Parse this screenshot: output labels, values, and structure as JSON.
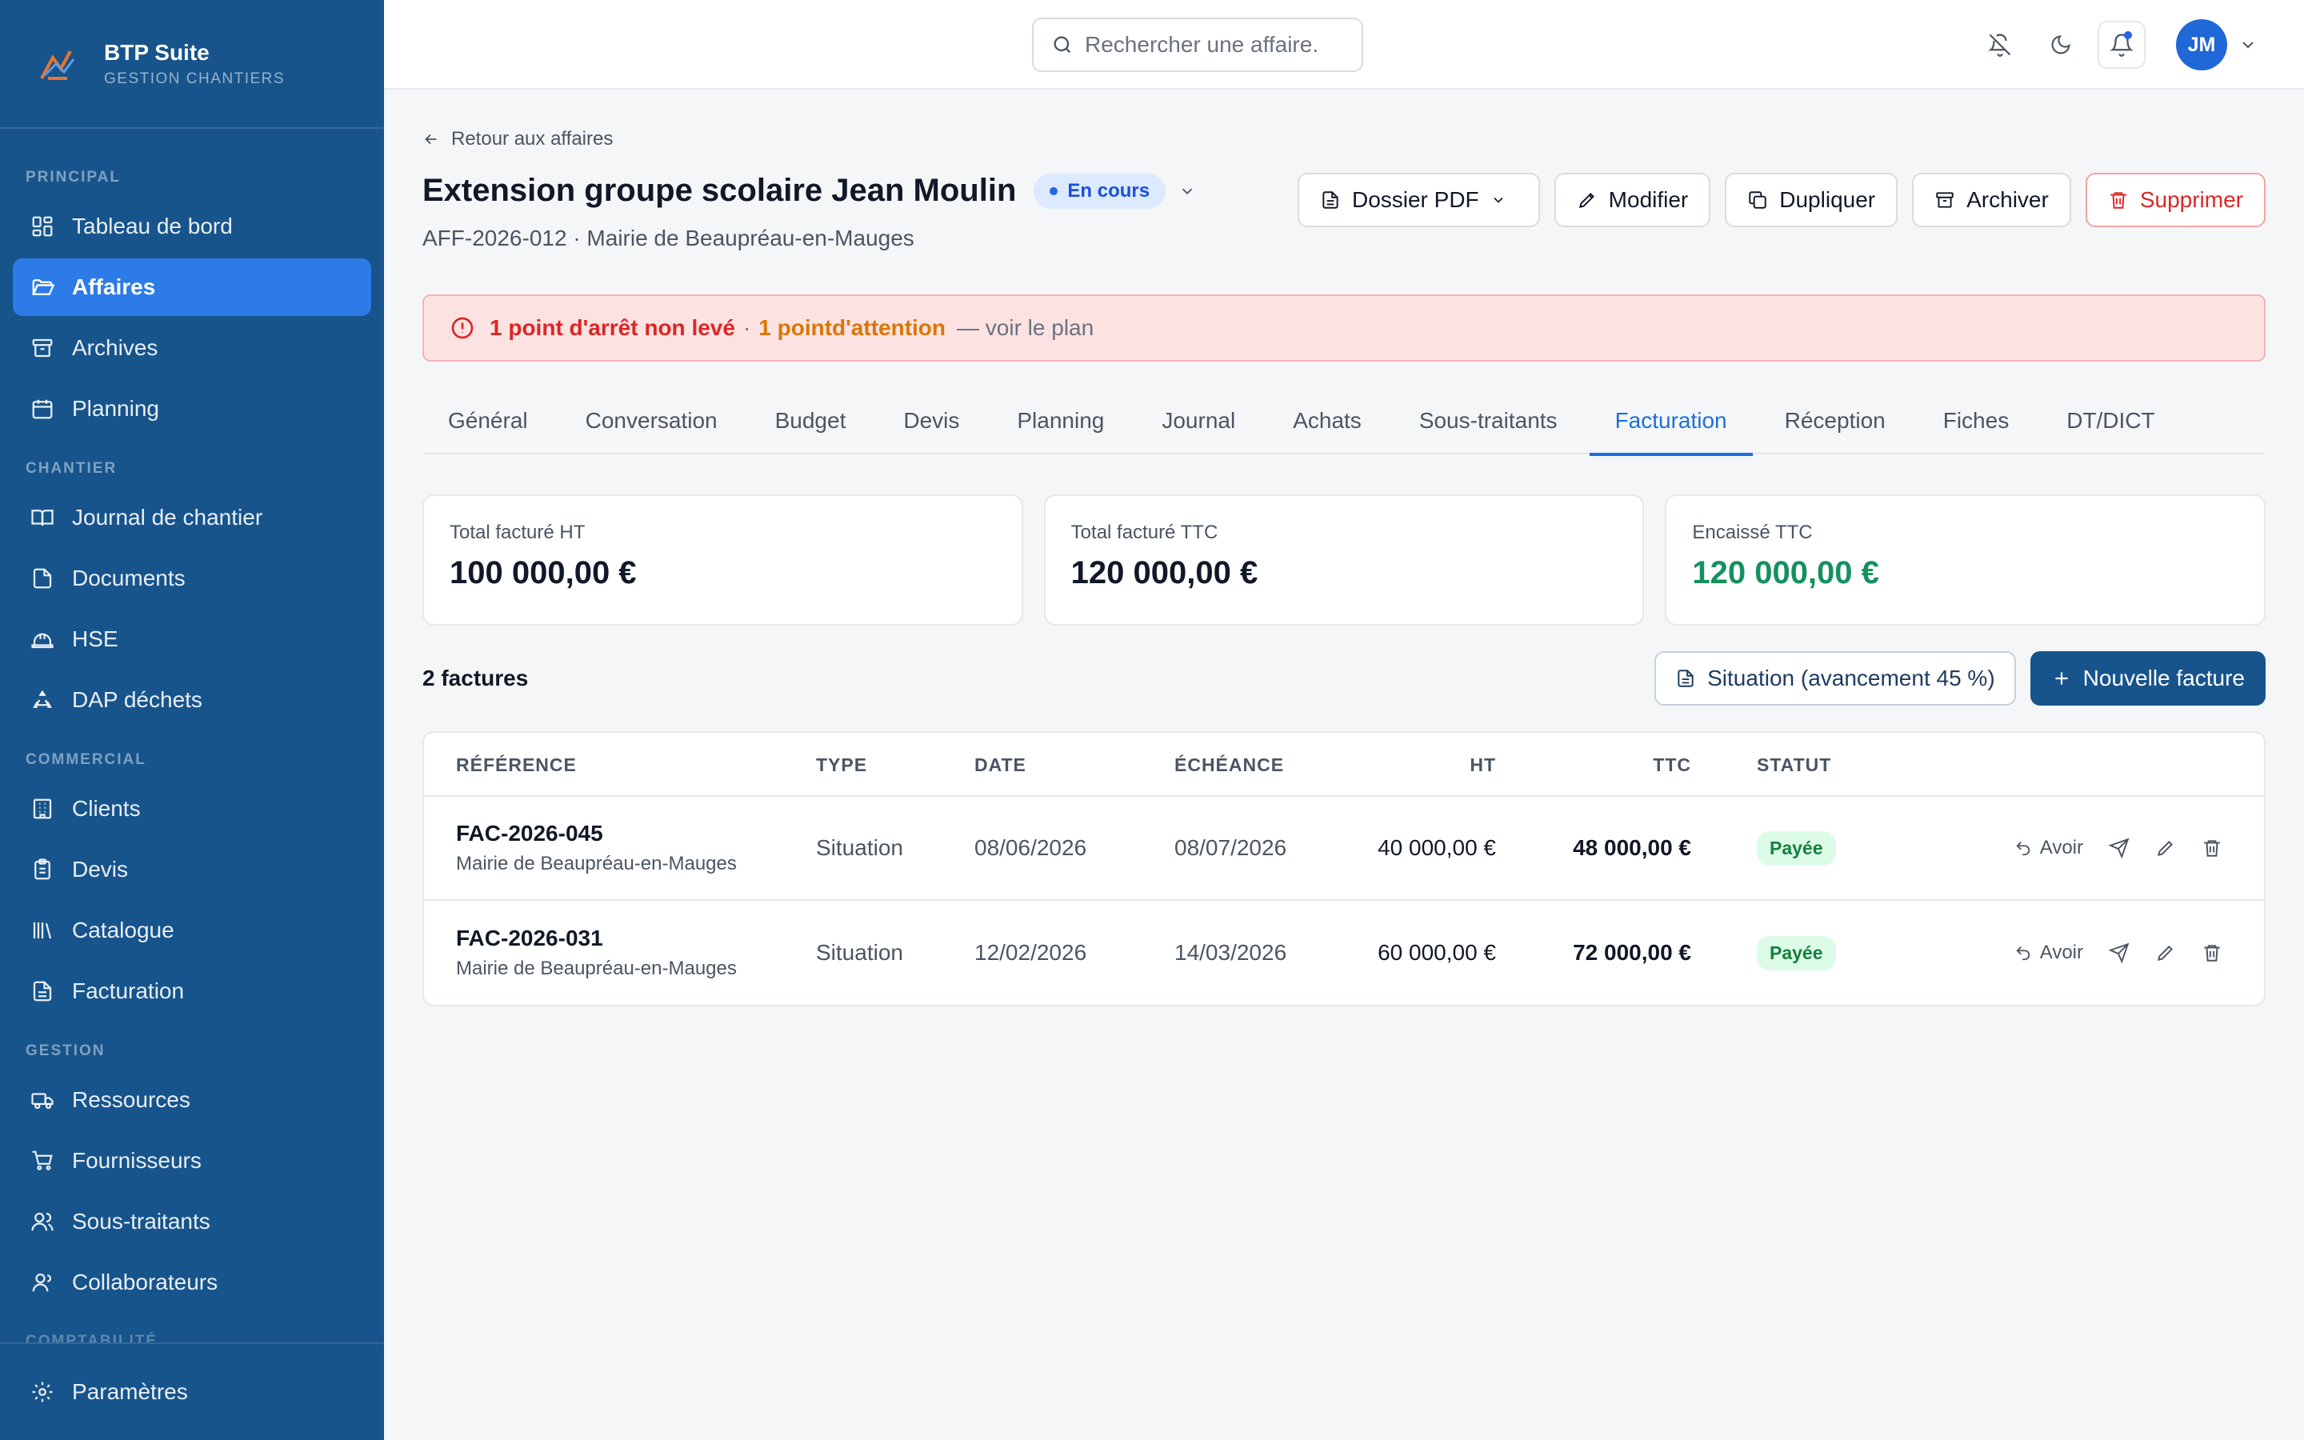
{
  "app": {
    "name": "BTP Suite",
    "subtitle": "GESTION CHANTIERS"
  },
  "sidebar": {
    "sections": [
      {
        "title": "PRINCIPAL",
        "items": [
          {
            "label": "Tableau de bord",
            "icon": "dashboard-icon"
          },
          {
            "label": "Affaires",
            "icon": "folder-open-icon",
            "active": true
          },
          {
            "label": "Archives",
            "icon": "archive-icon"
          },
          {
            "label": "Planning",
            "icon": "calendar-icon"
          }
        ]
      },
      {
        "title": "CHANTIER",
        "items": [
          {
            "label": "Journal de chantier",
            "icon": "book-icon"
          },
          {
            "label": "Documents",
            "icon": "document-icon"
          },
          {
            "label": "HSE",
            "icon": "hard-hat-icon"
          },
          {
            "label": "DAP déchets",
            "icon": "recycle-icon"
          }
        ]
      },
      {
        "title": "COMMERCIAL",
        "items": [
          {
            "label": "Clients",
            "icon": "building-icon"
          },
          {
            "label": "Devis",
            "icon": "clipboard-icon"
          },
          {
            "label": "Catalogue",
            "icon": "library-icon"
          },
          {
            "label": "Facturation",
            "icon": "receipt-icon"
          }
        ]
      },
      {
        "title": "GESTION",
        "items": [
          {
            "label": "Ressources",
            "icon": "truck-icon"
          },
          {
            "label": "Fournisseurs",
            "icon": "cart-icon"
          },
          {
            "label": "Sous-traitants",
            "icon": "users-icon"
          },
          {
            "label": "Collaborateurs",
            "icon": "user-icon"
          }
        ]
      }
    ],
    "hidden_section": "COMPTABILITÉ",
    "footer": {
      "label": "Paramètres",
      "icon": "gear-icon"
    }
  },
  "topbar": {
    "search_placeholder": "Rechercher une affaire.",
    "avatar_initials": "JM"
  },
  "page": {
    "back_label": "Retour aux affaires",
    "title": "Extension groupe scolaire Jean Moulin",
    "status": "En cours",
    "subtitle": "AFF-2026-012 · Mairie de Beaupréau-en-Mauges",
    "actions": {
      "pdf": "Dossier PDF",
      "edit": "Modifier",
      "duplicate": "Dupliquer",
      "archive": "Archiver",
      "delete": "Supprimer"
    },
    "alert": {
      "stop_points": "1 point d'arrêt non levé",
      "separator": "·",
      "attention_points": "1 pointd'attention",
      "link": "— voir le plan"
    },
    "tabs": [
      "Général",
      "Conversation",
      "Budget",
      "Devis",
      "Planning",
      "Journal",
      "Achats",
      "Sous-traitants",
      "Facturation",
      "Réception",
      "Fiches",
      "DT/DICT"
    ],
    "active_tab": "Facturation"
  },
  "summary": {
    "ht": {
      "label": "Total facturé HT",
      "value": "100 000,00 €"
    },
    "ttc": {
      "label": "Total facturé TTC",
      "value": "120 000,00 €"
    },
    "paid": {
      "label": "Encaissé TTC",
      "value": "120 000,00 €"
    }
  },
  "invoices": {
    "count_label": "2 factures",
    "situation_button": "Situation (avancement 45 %)",
    "new_button": "Nouvelle facture",
    "columns": {
      "ref": "RÉFÉRENCE",
      "type": "TYPE",
      "date": "DATE",
      "due": "ÉCHÉANCE",
      "ht": "HT",
      "ttc": "TTC",
      "status": "STATUT"
    },
    "rows": [
      {
        "ref": "FAC-2026-045",
        "client": "Mairie de Beaupréau-en-Mauges",
        "type": "Situation",
        "date": "08/06/2026",
        "due": "08/07/2026",
        "ht": "40 000,00 €",
        "ttc": "48 000,00 €",
        "status": "Payée",
        "credit_label": "Avoir"
      },
      {
        "ref": "FAC-2026-031",
        "client": "Mairie de Beaupréau-en-Mauges",
        "type": "Situation",
        "date": "12/02/2026",
        "due": "14/03/2026",
        "ht": "60 000,00 €",
        "ttc": "72 000,00 €",
        "status": "Payée",
        "credit_label": "Avoir"
      }
    ]
  },
  "colors": {
    "sidebar": "#17548c",
    "active_nav": "#2d7be6",
    "accent": "#1d6fdb",
    "danger": "#dc2626",
    "warning": "#d97706",
    "success": "#15905f"
  }
}
